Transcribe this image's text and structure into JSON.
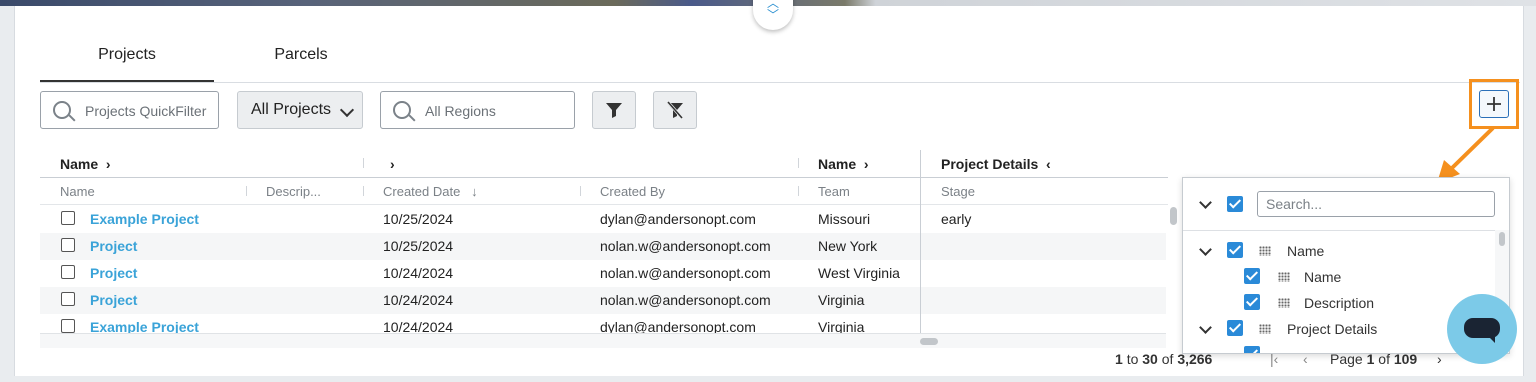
{
  "tabs": [
    {
      "label": "Projects",
      "active": true
    },
    {
      "label": "Parcels",
      "active": false
    }
  ],
  "toolbar": {
    "quickfilter_placeholder": "Projects QuickFilter",
    "projects_select_value": "All Projects",
    "regions_placeholder": "All Regions"
  },
  "column_groups": {
    "group1": "Name",
    "group3": "Name",
    "group4": "Project Details"
  },
  "columns": {
    "name": "Name",
    "description": "Descrip...",
    "created_date": "Created Date",
    "created_by": "Created By",
    "team": "Team",
    "stage": "Stage"
  },
  "rows": [
    {
      "name": "Example Project",
      "created_date": "10/25/2024",
      "created_by": "dylan@andersonopt.com",
      "team": "Missouri",
      "stage": "early"
    },
    {
      "name": "Project",
      "created_date": "10/25/2024",
      "created_by": "nolan.w@andersonopt.com",
      "team": "New York",
      "stage": ""
    },
    {
      "name": "Project",
      "created_date": "10/24/2024",
      "created_by": "nolan.w@andersonopt.com",
      "team": "West Virginia",
      "stage": ""
    },
    {
      "name": "Project",
      "created_date": "10/24/2024",
      "created_by": "nolan.w@andersonopt.com",
      "team": "Virginia",
      "stage": ""
    },
    {
      "name": "Example Project",
      "created_date": "10/24/2024",
      "created_by": "dylan@andersonopt.com",
      "team": "Virginia",
      "stage": ""
    }
  ],
  "pagination": {
    "from": "1",
    "to_word": "to",
    "to": "30",
    "of_word": "of",
    "total": "3,266",
    "page_word": "Page",
    "page": "1",
    "of_word2": "of",
    "pages": "109"
  },
  "column_panel": {
    "search_placeholder": "Search...",
    "items": [
      {
        "label": "Name",
        "level": 0
      },
      {
        "label": "Name",
        "level": 1
      },
      {
        "label": "Description",
        "level": 1
      },
      {
        "label": "Project Details",
        "level": 0
      }
    ]
  },
  "colors": {
    "accent": "#2a8ad8",
    "link": "#3aa3d8",
    "highlight": "#f5901e",
    "chat": "#7ccae8"
  }
}
